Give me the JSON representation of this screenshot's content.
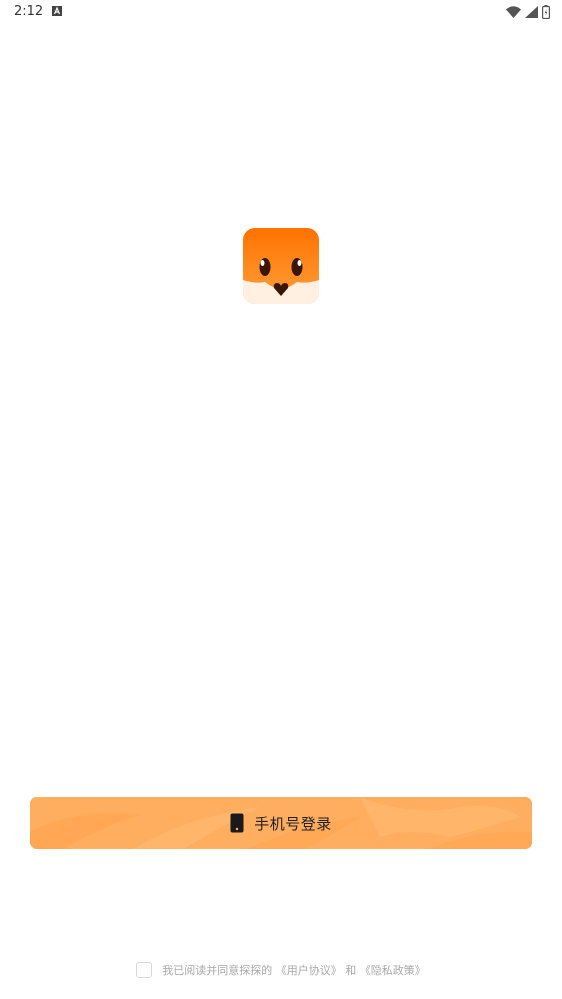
{
  "status_bar": {
    "time": "2:12",
    "notification_icon": "a-icon",
    "wifi_icon": "wifi-icon",
    "signal_icon": "signal-icon",
    "battery_icon": "battery-icon"
  },
  "logo": {
    "icon": "fox-app-logo",
    "colors": {
      "orange_top": "#ff7a00",
      "orange_light": "#ff9a2e",
      "cream": "#fff0e1",
      "dark": "#4a1d0b"
    }
  },
  "login": {
    "label": "手机号登录",
    "icon": "phone-icon",
    "color": "#ffae60"
  },
  "agreement": {
    "prefix": "我已阅读并同意探探的",
    "user_agreement": "《用户协议》",
    "conjunction": "和",
    "privacy_policy": "《隐私政策》",
    "checked": false
  }
}
